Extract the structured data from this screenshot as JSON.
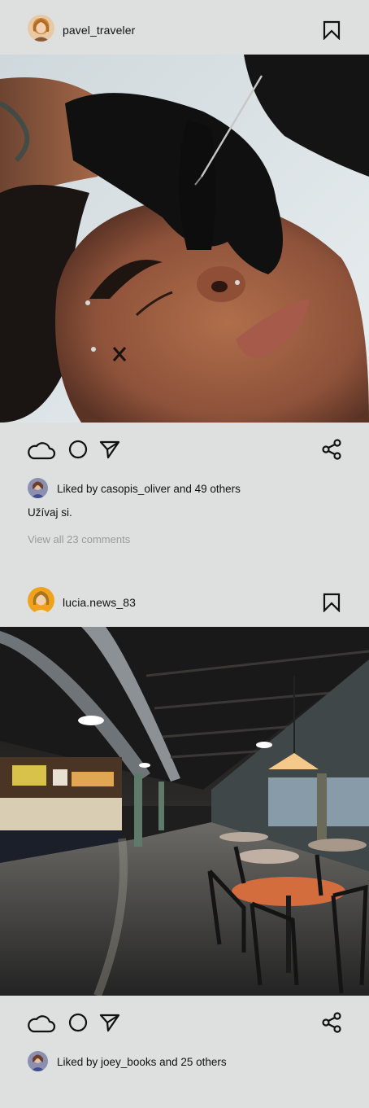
{
  "posts": [
    {
      "username": "pavel_traveler",
      "avatar_icon": "user-avatar-icon",
      "liked_by_user": "casopis_oliver",
      "likes_text": "Liked by casopis_oliver and 49 others",
      "caption": "Užívaj si.",
      "view_comments": "View all 23 comments",
      "photo_subject": "piercing procedure close-up"
    },
    {
      "username": "lucia.news_83",
      "avatar_icon": "user-avatar-icon",
      "liked_by_user": "joey_books",
      "likes_text": "Liked by joey_books and 25 others",
      "photo_subject": "food court interior"
    }
  ],
  "icons": {
    "like": "cloud-like-icon",
    "comment": "comment-bubble-icon",
    "send": "send-arrow-icon",
    "share": "share-icon",
    "bookmark": "bookmark-icon"
  },
  "colors": {
    "background": "#dee0e0",
    "text": "#111111",
    "muted": "#9a9a9a"
  }
}
